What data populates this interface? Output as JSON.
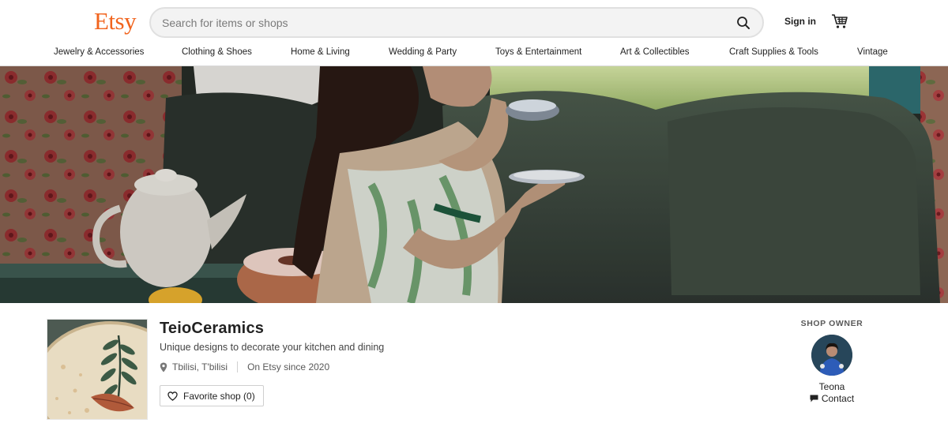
{
  "brand": {
    "logo_text": "Etsy",
    "color": "#F1641E"
  },
  "search": {
    "placeholder": "Search for items or shops",
    "value": "",
    "icon": "search-icon"
  },
  "header": {
    "signin_label": "Sign in",
    "cart_icon": "cart-icon"
  },
  "categories": [
    "Jewelry & Accessories",
    "Clothing & Shoes",
    "Home & Living",
    "Wedding & Party",
    "Toys & Entertainment",
    "Art & Collectibles",
    "Craft Supplies & Tools",
    "Vintage"
  ],
  "shop": {
    "name": "TeioCeramics",
    "tagline": "Unique designs to decorate your kitchen and dining",
    "location": "Tbilisi, T'bilisi",
    "since": "On Etsy since 2020",
    "favorite_label": "Favorite shop (0)",
    "location_icon": "map-pin-icon",
    "favorite_icon": "heart-icon"
  },
  "owner": {
    "heading": "SHOP OWNER",
    "name": "Teona",
    "contact_label": "Contact",
    "contact_icon": "message-icon"
  }
}
